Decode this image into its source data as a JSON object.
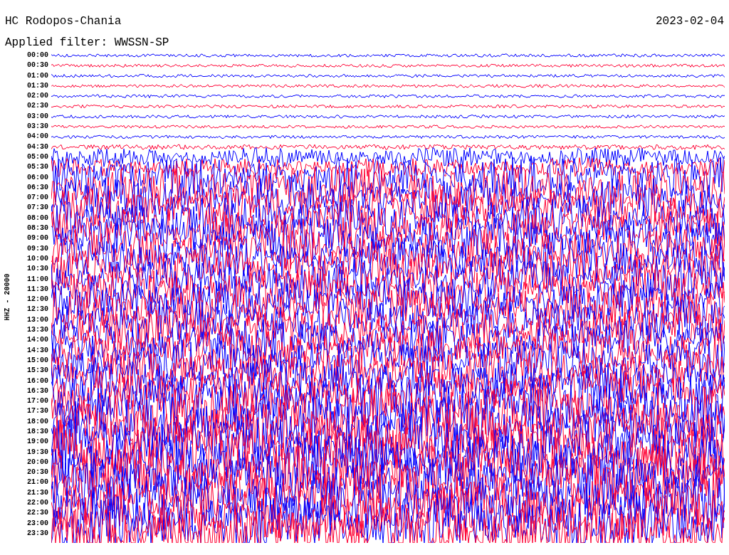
{
  "header": {
    "station": "HC Rodopos-Chania",
    "date": "2023-02-04",
    "filter": "Applied filter: WWSSN-SP"
  },
  "axis_label": "HHZ - 20000",
  "time_labels": [
    "00:00",
    "00:30",
    "01:00",
    "01:30",
    "02:00",
    "02:30",
    "03:00",
    "03:30",
    "04:00",
    "04:30",
    "05:00",
    "05:30",
    "06:00",
    "06:30",
    "07:00",
    "07:30",
    "08:00",
    "08:30",
    "09:00",
    "09:30",
    "10:00",
    "10:30",
    "11:00",
    "11:30",
    "12:00",
    "12:30",
    "13:00",
    "13:30",
    "14:00",
    "14:30",
    "15:00",
    "15:30",
    "16:00",
    "16:30",
    "17:00",
    "17:30",
    "18:00",
    "18:30",
    "19:00",
    "19:30",
    "20:00",
    "20:30",
    "21:00",
    "21:30",
    "22:00",
    "22:30",
    "23:00",
    "23:30"
  ]
}
